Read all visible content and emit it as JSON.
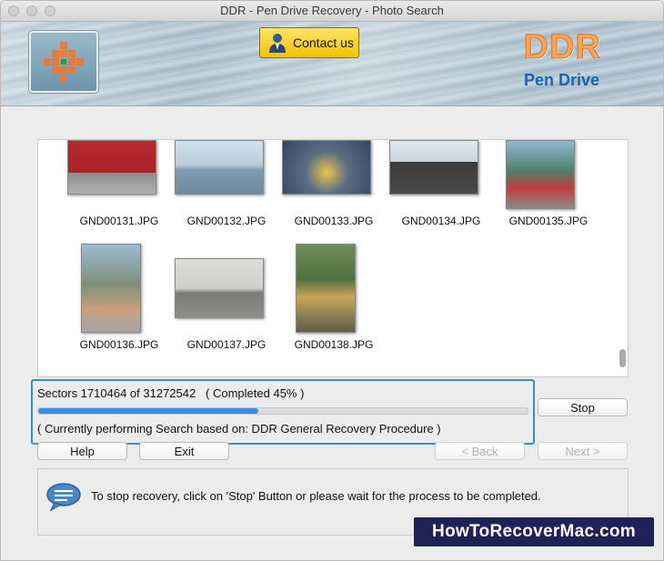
{
  "window": {
    "title": "DDR - Pen Drive Recovery - Photo Search"
  },
  "header": {
    "contact_label": "Contact us",
    "brand": "DDR",
    "product": "Pen Drive",
    "logo_icon": "ddr-logo-icon"
  },
  "photos": [
    {
      "name": "GND00131.JPG"
    },
    {
      "name": "GND00132.JPG"
    },
    {
      "name": "GND00133.JPG"
    },
    {
      "name": "GND00134.JPG"
    },
    {
      "name": "GND00135.JPG"
    },
    {
      "name": "GND00136.JPG"
    },
    {
      "name": "GND00137.JPG"
    },
    {
      "name": "GND00138.JPG"
    }
  ],
  "progress": {
    "sectors_text": "Sectors 1710464 of 31272542",
    "completed_text": "( Completed 45% )",
    "completed_fraction": 0.45,
    "current_text": "( Currently performing Search based on: DDR General Recovery Procedure )"
  },
  "buttons": {
    "stop": "Stop",
    "help": "Help",
    "exit": "Exit",
    "back": "< Back",
    "next": "Next >"
  },
  "info": {
    "icon": "speech-bubble-icon",
    "text": "To stop recovery, click on 'Stop' Button or please wait for the process to be completed."
  },
  "watermark": "HowToRecoverMac.com",
  "colors": {
    "accent": "#2f8fd7",
    "progress_fill": "#3b8ee7",
    "contact_button": "#f2c400",
    "brand_orange": "#f6a55b",
    "brand_blue": "#1a63b0",
    "watermark_bg": "#1e2257"
  }
}
